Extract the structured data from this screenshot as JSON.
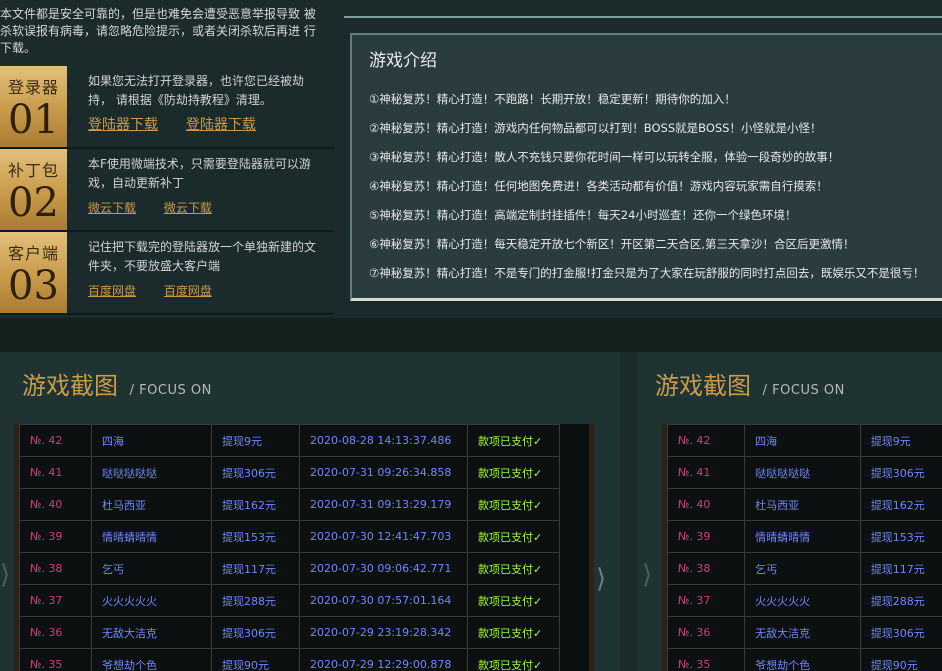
{
  "notice": "本文件都是安全可靠的，但是也难免会遭受恶意举报导致 被杀软误报有病毒，请忽略危险提示，或者关闭杀软后再进 行下载。",
  "downloads": [
    {
      "title": "登录器",
      "num": "01",
      "desc": "如果您无法打开登录器，也许您已经被劫持，  请根据《防劫持教程》清理。",
      "links": [
        "登陆器下载",
        "登陆器下载"
      ]
    },
    {
      "title": "补丁包",
      "num": "02",
      "desc": "本F使用微端技术，只需要登陆器就可以游戏，自动更新补丁",
      "links": [
        "微云下载",
        "微云下载"
      ]
    },
    {
      "title": "客户端",
      "num": "03",
      "desc": "记住把下载完的登陆器放一个单独新建的文件夹，不要放盛大客户端",
      "links": [
        "百度网盘",
        "百度网盘"
      ]
    }
  ],
  "intro": {
    "title": "游戏介绍",
    "items": [
      "①神秘复苏！精心打造！不跑路！长期开放！稳定更新！期待你的加入！",
      "②神秘复苏！精心打造！游戏内任何物品都可以打到！BOSS就是BOSS！小怪就是小怪！",
      "③神秘复苏！精心打造！散人不充钱只要你花时间一样可以玩转全服，体验一段奇妙的故事！",
      "④神秘复苏！精心打造！任何地图免费进！各类活动都有价值！游戏内容玩家需自行摸索！",
      "⑤神秘复苏！精心打造！高端定制封挂插件！每天24小时巡查！还你一个绿色环境！",
      "⑥神秘复苏！精心打造！每天稳定开放七个新区！开区第二天合区,第三天拿沙！合区后更激情！",
      "⑦神秘复苏！精心打造！不是专门的打金服!打金只是为了大家在玩舒服的同时打点回去，既娱乐又不是很亏！"
    ]
  },
  "screenshots": {
    "title": "游戏截图",
    "subtitle": "/ FOCUS ON"
  },
  "records": [
    {
      "no": "№. 42",
      "name": "四海",
      "amount": "提现9元",
      "time": "2020-08-28 14:13:37.486",
      "status": "款项已支付✓"
    },
    {
      "no": "№. 41",
      "name": "哒哒哒哒哒",
      "amount": "提现306元",
      "time": "2020-07-31 09:26:34.858",
      "status": "款项已支付✓"
    },
    {
      "no": "№. 40",
      "name": "杜马西亚",
      "amount": "提现162元",
      "time": "2020-07-31 09:13:29.179",
      "status": "款项已支付✓"
    },
    {
      "no": "№. 39",
      "name": "情晴蜻晴情",
      "amount": "提现153元",
      "time": "2020-07-30 12:41:47.703",
      "status": "款项已支付✓"
    },
    {
      "no": "№. 38",
      "name": "乞丐",
      "amount": "提现117元",
      "time": "2020-07-30 09:06:42.771",
      "status": "款项已支付✓"
    },
    {
      "no": "№. 37",
      "name": "火火火火火",
      "amount": "提现288元",
      "time": "2020-07-30 07:57:01.164",
      "status": "款项已支付✓"
    },
    {
      "no": "№. 36",
      "name": "无敌大洁克",
      "amount": "提现306元",
      "time": "2020-07-29 23:19:28.342",
      "status": "款项已支付✓"
    },
    {
      "no": "№. 35",
      "name": "爷想劫个色",
      "amount": "提现90元",
      "time": "2020-07-29 12:29:00.878",
      "status": "款项已支付✓"
    }
  ],
  "arrows": {
    "left": "⟩",
    "right": "⟩"
  }
}
